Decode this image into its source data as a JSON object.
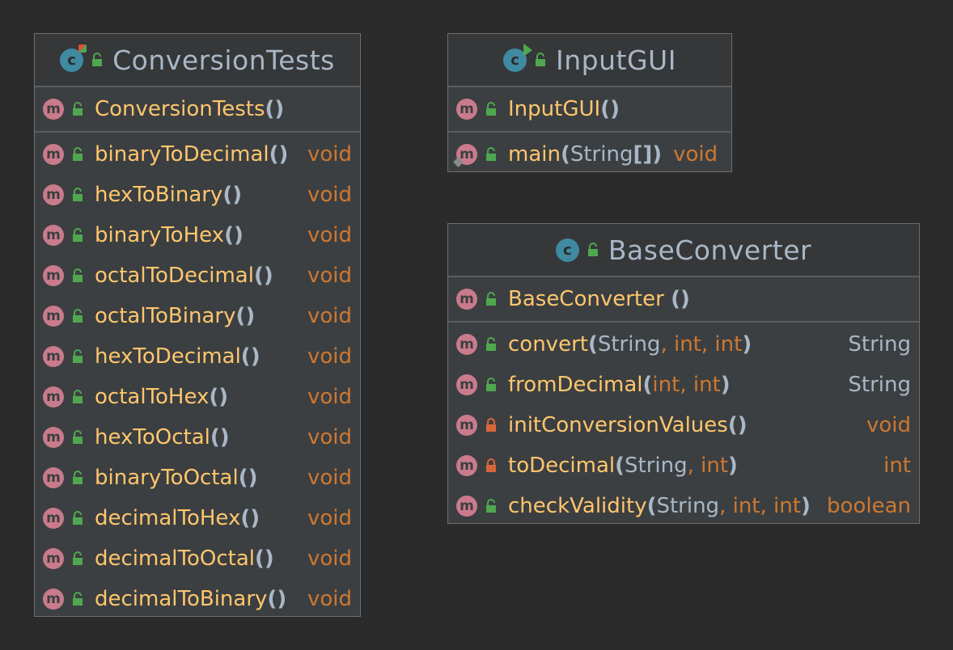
{
  "colors": {
    "background": "#2b2b2b",
    "class_body": "#3c3f41",
    "method_name": "#ffc66d",
    "keyword": "#cc7832",
    "reference_type": "#a9b7c6",
    "method_badge": "#c97b8c",
    "class_badge": "#3f8aa1",
    "public_lock": "#4fa84f",
    "private_lock": "#d9653b"
  },
  "classes": {
    "conversion_tests": {
      "name": "ConversionTests",
      "badge_letter": "c",
      "icon": "test-class-icon",
      "constructor": {
        "name": "ConversionTests",
        "open": "(",
        "close": ")"
      },
      "methods": [
        {
          "name": "binaryToDecimal",
          "open": "(",
          "close": ")",
          "returns": "void"
        },
        {
          "name": "hexToBinary",
          "open": "(",
          "close": ")",
          "returns": "void"
        },
        {
          "name": "binaryToHex",
          "open": "(",
          "close": ")",
          "returns": "void"
        },
        {
          "name": "octalToDecimal",
          "open": "(",
          "close": ")",
          "returns": "void"
        },
        {
          "name": "octalToBinary",
          "open": "(",
          "close": ")",
          "returns": "void"
        },
        {
          "name": "hexToDecimal",
          "open": "(",
          "close": ")",
          "returns": "void"
        },
        {
          "name": "octalToHex",
          "open": "(",
          "close": ")",
          "returns": "void"
        },
        {
          "name": "hexToOctal",
          "open": "(",
          "close": ")",
          "returns": "void"
        },
        {
          "name": "binaryToOctal",
          "open": "(",
          "close": ")",
          "returns": "void"
        },
        {
          "name": "decimalToHex",
          "open": "(",
          "close": ")",
          "returns": "void"
        },
        {
          "name": "decimalToOctal",
          "open": "(",
          "close": ")",
          "returns": "void"
        },
        {
          "name": "decimalToBinary",
          "open": "(",
          "close": ")",
          "returns": "void"
        }
      ]
    },
    "input_gui": {
      "name": "InputGUI",
      "badge_letter": "c",
      "icon": "runnable-class-icon",
      "constructor": {
        "name": "InputGUI",
        "open": "(",
        "close": ")"
      },
      "methods": [
        {
          "name": "main",
          "open": "(",
          "param1": "String",
          "brackets": "[]",
          "close": ")",
          "returns": "void",
          "static": true
        }
      ]
    },
    "base_converter": {
      "name": "BaseConverter",
      "badge_letter": "c",
      "icon": "class-icon",
      "constructor": {
        "name": "BaseConverter",
        "open": "(",
        "close": ")"
      },
      "methods": [
        {
          "name": "convert",
          "open": "(",
          "p1": "String",
          "c1": ",",
          "p2": "int",
          "c2": ",",
          "p3": "int",
          "close": ")",
          "returns": "String",
          "access": "public"
        },
        {
          "name": "fromDecimal",
          "open": "(",
          "p1": "int",
          "c1": ",",
          "p2": "int",
          "close": ")",
          "returns": "String",
          "access": "public"
        },
        {
          "name": "initConversionValues",
          "open": "(",
          "close": ")",
          "returns": "void",
          "access": "private"
        },
        {
          "name": "toDecimal",
          "open": "(",
          "p1": "String",
          "c1": ",",
          "p2": "int",
          "close": ")",
          "returns": "int",
          "access": "private"
        },
        {
          "name": "checkValidity",
          "open": "(",
          "p1": "String",
          "c1": ",",
          "p2": "int",
          "c2": ",",
          "p3": "int",
          "close": ")",
          "returns": "boolean",
          "access": "public"
        }
      ]
    }
  },
  "method_badge_letter": "m"
}
